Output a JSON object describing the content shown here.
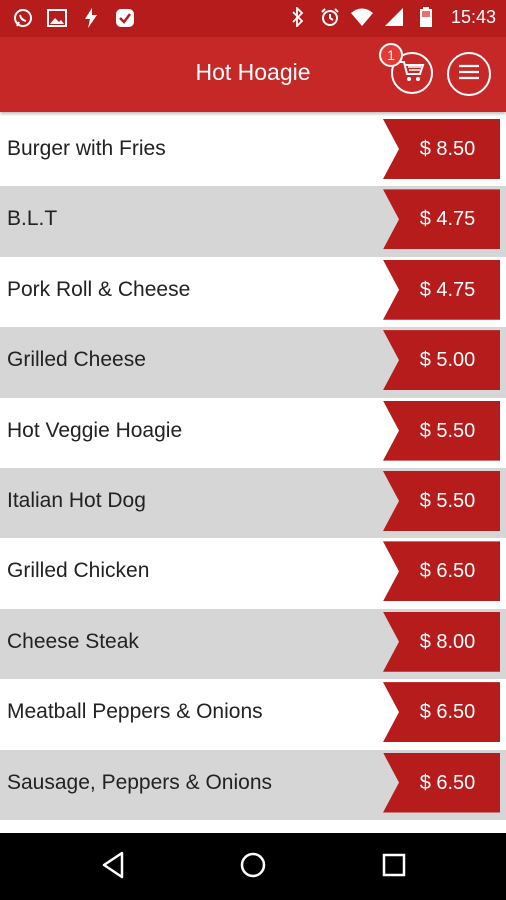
{
  "status_bar": {
    "time": "15:43",
    "left_icons": [
      "whatsapp-icon",
      "image-icon",
      "flash-icon",
      "check-shield-icon"
    ],
    "right_icons": [
      "bluetooth-icon",
      "alarm-icon",
      "wifi-icon",
      "signal-icon",
      "battery-icon"
    ]
  },
  "header": {
    "title": "Hot Hoagie",
    "cart_count": "1"
  },
  "menu_items": [
    {
      "name": "Burger with Fries",
      "price": "$ 8.50"
    },
    {
      "name": "B.L.T",
      "price": "$ 4.75"
    },
    {
      "name": "Pork Roll & Cheese",
      "price": "$ 4.75"
    },
    {
      "name": "Grilled Cheese",
      "price": "$ 5.00"
    },
    {
      "name": "Hot Veggie Hoagie",
      "price": "$ 5.50"
    },
    {
      "name": "Italian Hot Dog",
      "price": "$ 5.50"
    },
    {
      "name": "Grilled Chicken",
      "price": "$ 6.50"
    },
    {
      "name": "Cheese Steak",
      "price": "$ 8.00"
    },
    {
      "name": "Meatball Peppers & Onions",
      "price": "$ 6.50"
    },
    {
      "name": "Sausage, Peppers & Onions",
      "price": "$ 6.50"
    }
  ],
  "colors": {
    "primary": "#c62828",
    "price_tag": "#b71c1c",
    "row_alt": "#d6d6d6"
  },
  "nav_icons": [
    "back-icon",
    "home-icon",
    "recents-icon"
  ]
}
